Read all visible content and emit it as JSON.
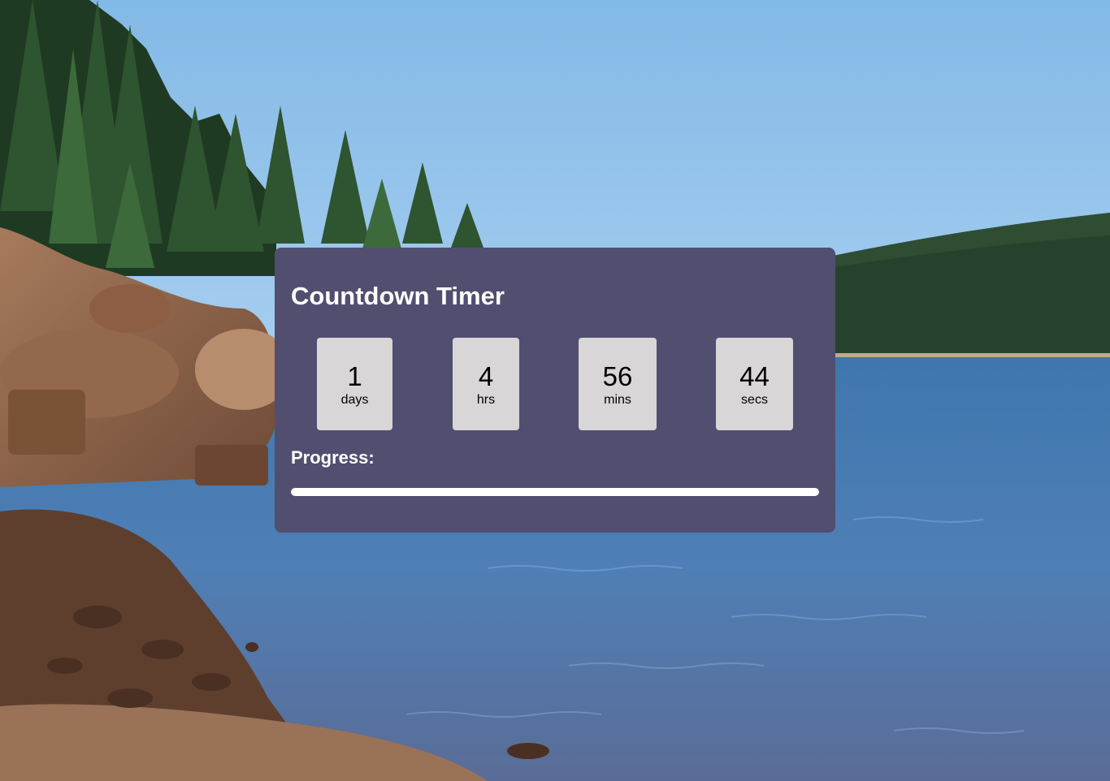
{
  "colors": {
    "card_background": "#524e70",
    "tile_background": "#d8d6d7",
    "text_light": "#ffffff",
    "text_dark": "#000000",
    "progress_fill": "#ffffff"
  },
  "timer": {
    "title": "Countdown Timer",
    "units": [
      {
        "value": "1",
        "label": "days"
      },
      {
        "value": "4",
        "label": "hrs"
      },
      {
        "value": "56",
        "label": "mins"
      },
      {
        "value": "44",
        "label": "secs"
      }
    ],
    "progress_label": "Progress:",
    "progress_fraction": 1.0
  }
}
